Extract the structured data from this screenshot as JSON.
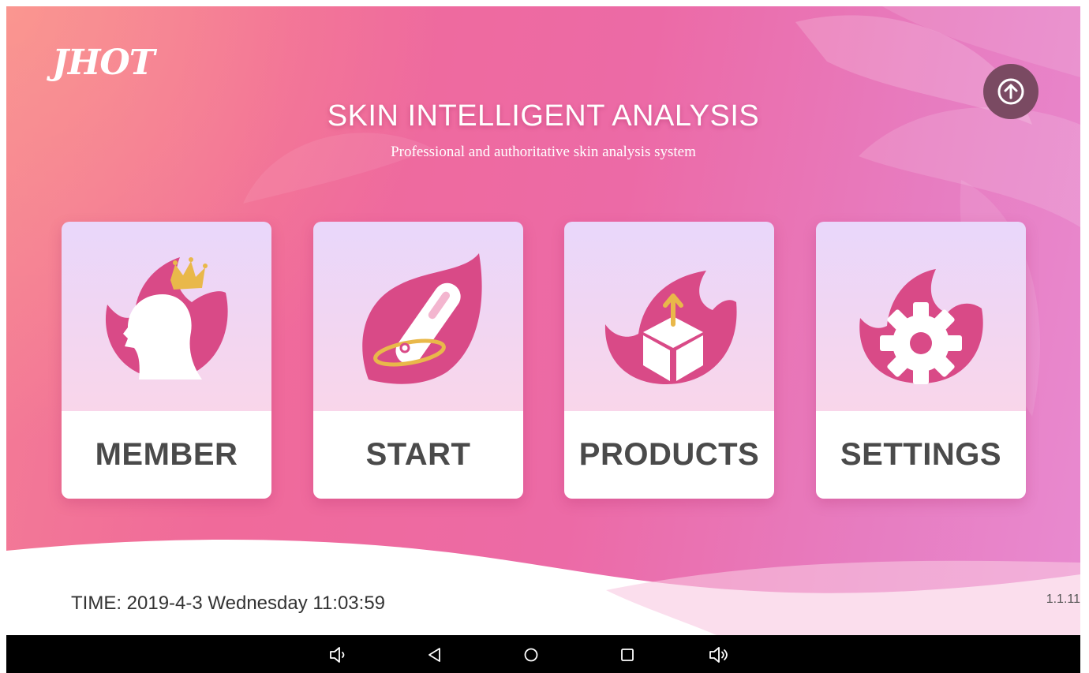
{
  "app": {
    "logo": "JHOT",
    "title": "SKIN INTELLIGENT ANALYSIS",
    "subtitle": "Professional and authoritative skin analysis system",
    "upload_icon": "circle-arrow-up-icon"
  },
  "menu": [
    {
      "label": "MEMBER",
      "icon": "woman-crown-icon"
    },
    {
      "label": "START",
      "icon": "skin-detector-icon"
    },
    {
      "label": "PRODUCTS",
      "icon": "box-upload-icon"
    },
    {
      "label": "SETTINGS",
      "icon": "gear-icon"
    }
  ],
  "footer": {
    "time": "TIME: 2019-4-3 Wednesday  11:03:59",
    "version": "1.1.11"
  },
  "navbar": [
    {
      "icon": "volume-down-icon"
    },
    {
      "icon": "back-icon"
    },
    {
      "icon": "home-icon"
    },
    {
      "icon": "recents-icon"
    },
    {
      "icon": "volume-up-icon"
    }
  ],
  "colors": {
    "accent": "#d94a87",
    "gold": "#e9b84a",
    "label": "#4a4a4a"
  }
}
